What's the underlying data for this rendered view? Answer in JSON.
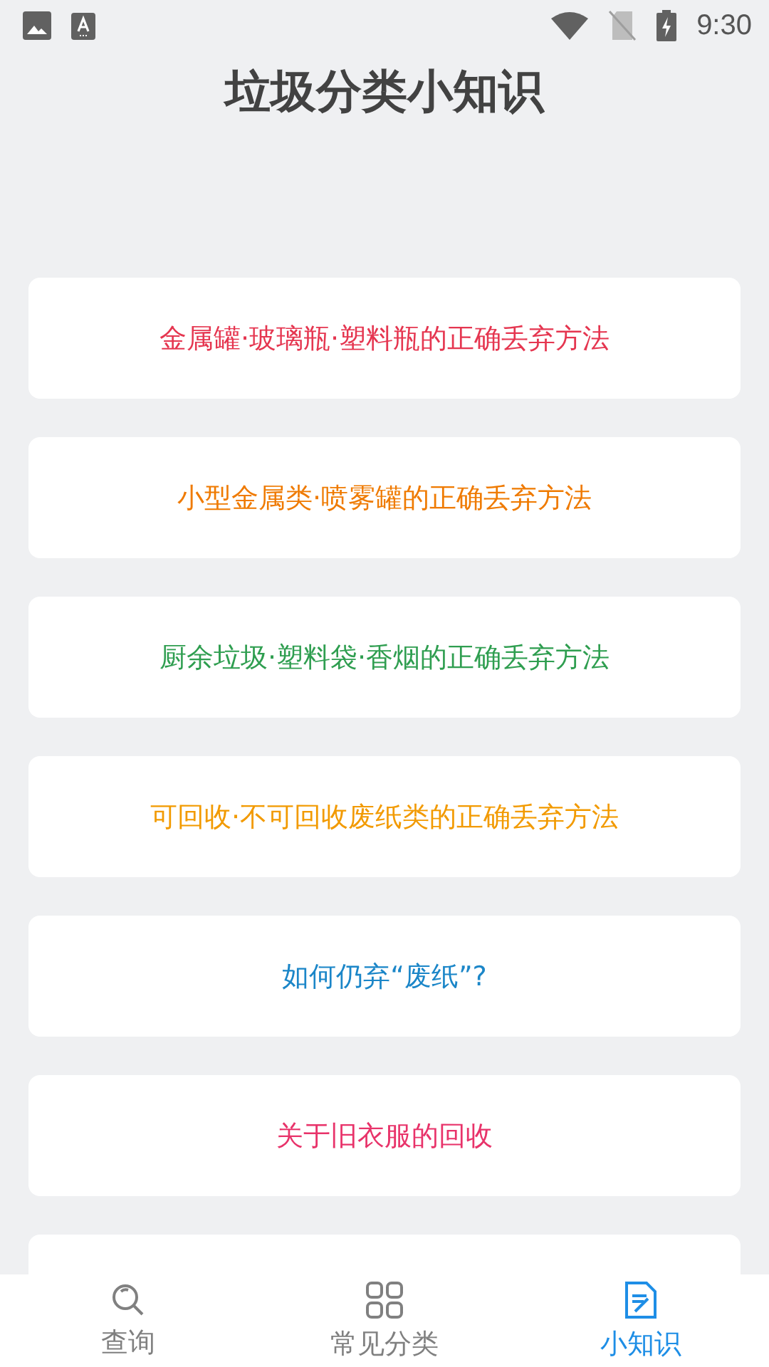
{
  "status_bar": {
    "time": "9:30"
  },
  "title": "垃圾分类小知识",
  "articles": [
    {
      "title": "金属罐·玻璃瓶·塑料瓶的正确丢弃方法",
      "color": "#e53650"
    },
    {
      "title": "小型金属类·喷雾罐的正确丢弃方法",
      "color": "#ef7a00"
    },
    {
      "title": "厨余垃圾·塑料袋·香烟的正确丢弃方法",
      "color": "#2f9e50"
    },
    {
      "title": "可回收·不可回收废纸类的正确丢弃方法",
      "color": "#f29a00"
    },
    {
      "title": "如何仍弃“废纸”?",
      "color": "#1b86c8"
    },
    {
      "title": "关于旧衣服的回收",
      "color": "#e8336a"
    }
  ],
  "nav": [
    {
      "label": "查询",
      "kind": "search",
      "selected": false
    },
    {
      "label": "常见分类",
      "kind": "grid",
      "selected": false
    },
    {
      "label": "小知识",
      "kind": "note",
      "selected": true
    }
  ]
}
